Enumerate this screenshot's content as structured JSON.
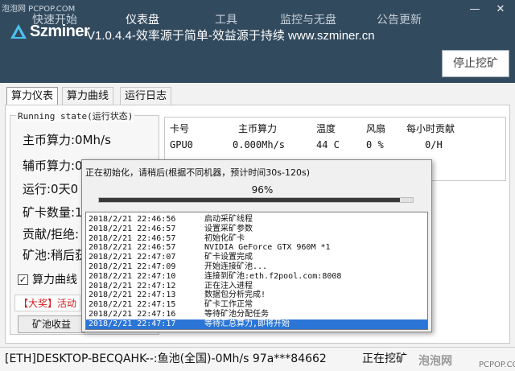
{
  "watermark": {
    "top_left": "泡泡网 PCPOP.COM",
    "bottom_brand": "泡泡网",
    "bottom_url": "PCPOP.COM"
  },
  "app": {
    "logo_text": "Szminer",
    "title": "V1.0.4.4-效率源于简单-效益源于持续 www.szminer.cn"
  },
  "window": {
    "minimize": "—",
    "close": "✕"
  },
  "nav": {
    "tabs": [
      "快速开始",
      "仪表盘",
      "工具",
      "监控与无盘",
      "公告更新"
    ],
    "active_index": 1,
    "stop_button": "停止挖矿"
  },
  "subtabs": [
    "算力仪表",
    "算力曲线",
    "运行日志"
  ],
  "running": {
    "group_title": "Running state(运行状态)",
    "stats": [
      "主币算力:0Mh/s",
      "辅币算力:0Mh/s",
      "运行:0天0",
      "矿卡数量:1",
      "贡献/拒绝:",
      "矿池:稍后获"
    ],
    "checkbox_label": "算力曲线",
    "checkbox_checked": "✓",
    "promo": "【大奖】活动",
    "pool_button": "矿池收益"
  },
  "gpu_table": {
    "headers": [
      "卡号",
      "主币算力",
      "温度",
      "风扇",
      "每小时贡献"
    ],
    "row": [
      "GPU0",
      "0.000Mh/s",
      "44 C",
      "0 %",
      "0/H"
    ]
  },
  "init_dialog": {
    "title": "正在初始化，请稍后(根据不同机器，预计时间30s-120s)",
    "percent_text": "96%",
    "progress": 0.96,
    "log": [
      {
        "ts": "2018/2/21  22:46:56",
        "msg": "启动采矿线程"
      },
      {
        "ts": "2018/2/21  22:46:57",
        "msg": "设置采矿参数"
      },
      {
        "ts": "2018/2/21  22:46:57",
        "msg": "初始化矿卡"
      },
      {
        "ts": "2018/2/21  22:46:57",
        "msg": "NVIDIA GeForce GTX 960M  *1"
      },
      {
        "ts": "2018/2/21  22:47:07",
        "msg": "矿卡设置完成"
      },
      {
        "ts": "2018/2/21  22:47:09",
        "msg": "开始连接矿池..."
      },
      {
        "ts": "2018/2/21  22:47:10",
        "msg": "连接到矿池:eth.f2pool.com:8008"
      },
      {
        "ts": "2018/2/21  22:47:12",
        "msg": "正在注入进程"
      },
      {
        "ts": "2018/2/21  22:47:13",
        "msg": "数据包分析完成!"
      },
      {
        "ts": "2018/2/21  22:47:15",
        "msg": "矿卡工作正常"
      },
      {
        "ts": "2018/2/21  22:47:16",
        "msg": "等待矿池分配任务"
      },
      {
        "ts": "2018/2/21  22:47:17",
        "msg": "等待汇总算力,即将开始"
      }
    ],
    "selected_index": 11
  },
  "statusbar": {
    "text": "[ETH]DESKTOP-BECQAHK--:鱼池(全国)-0Mh/s 97a***84662",
    "right": "正在挖矿"
  }
}
